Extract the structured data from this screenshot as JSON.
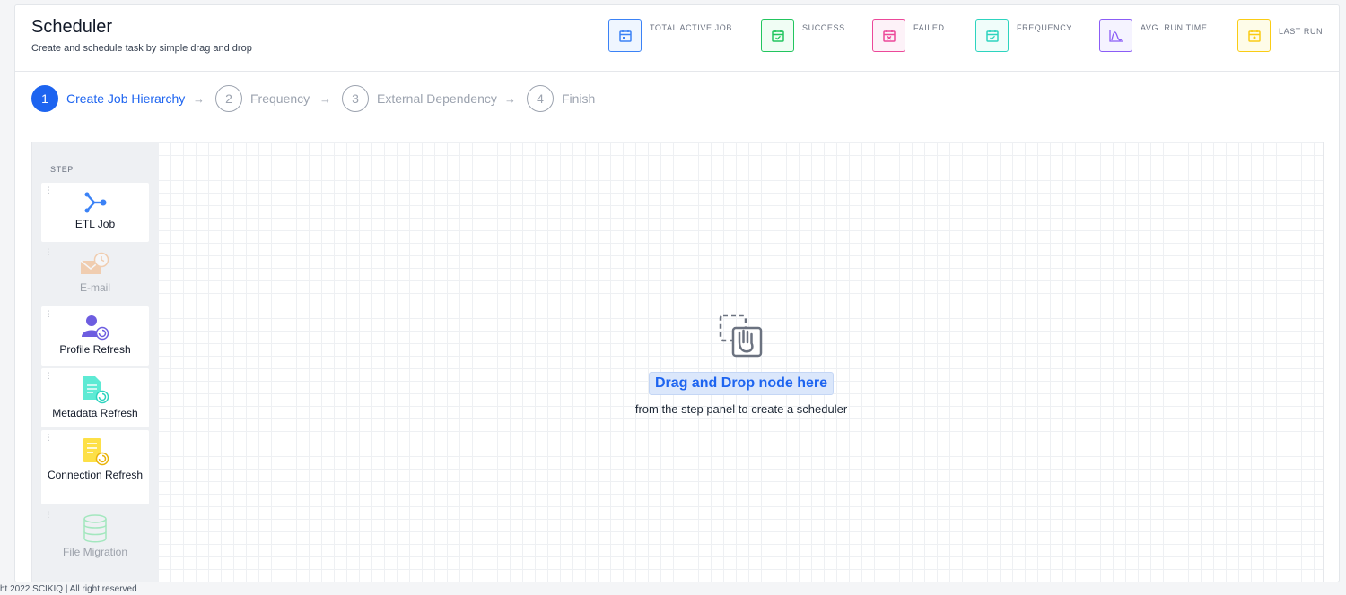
{
  "header": {
    "title": "Scheduler",
    "subtitle": "Create and schedule task by simple drag and drop"
  },
  "stats": [
    {
      "label": "TOTAL ACTIVE JOB",
      "icon": "calendar-icon",
      "color": "#3b82f6"
    },
    {
      "label": "SUCCESS",
      "icon": "calendar-check-icon",
      "color": "#22c55e"
    },
    {
      "label": "FAILED",
      "icon": "calendar-x-icon",
      "color": "#ec4899"
    },
    {
      "label": "FREQUENCY",
      "icon": "calendar-check-icon",
      "color": "#2dd4bf"
    },
    {
      "label": "AVG. RUN TIME",
      "icon": "chart-curve-icon",
      "color": "#8b5cf6"
    },
    {
      "label": "LAST RUN",
      "icon": "calendar-dot-icon",
      "color": "#facc15"
    }
  ],
  "stepper": {
    "steps": [
      {
        "number": "1",
        "label": "Create Job Hierarchy",
        "active": true
      },
      {
        "number": "2",
        "label": "Frequency",
        "active": false
      },
      {
        "number": "3",
        "label": "External Dependency",
        "active": false
      },
      {
        "number": "4",
        "label": "Finish",
        "active": false
      }
    ],
    "arrow": "→"
  },
  "step_panel": {
    "title": "STEP",
    "nodes": [
      {
        "label": "ETL Job",
        "icon": "etl-branch-icon",
        "enabled": true
      },
      {
        "label": "E-mail",
        "icon": "email-clock-icon",
        "enabled": false
      },
      {
        "label": "Profile Refresh",
        "icon": "profile-refresh-icon",
        "enabled": true
      },
      {
        "label": "Metadata Refresh",
        "icon": "metadata-refresh-icon",
        "enabled": true
      },
      {
        "label": "Connection Refresh",
        "icon": "connection-refresh-icon",
        "enabled": true
      },
      {
        "label": "File Migration",
        "icon": "database-icon",
        "enabled": false
      }
    ]
  },
  "dropzone": {
    "title": "Drag and Drop node here",
    "subtitle": "from the step panel to create a scheduler",
    "icon": "drag-hand-icon"
  },
  "footer": {
    "text": "ht 2022 SCIKIQ | All right reserved"
  }
}
